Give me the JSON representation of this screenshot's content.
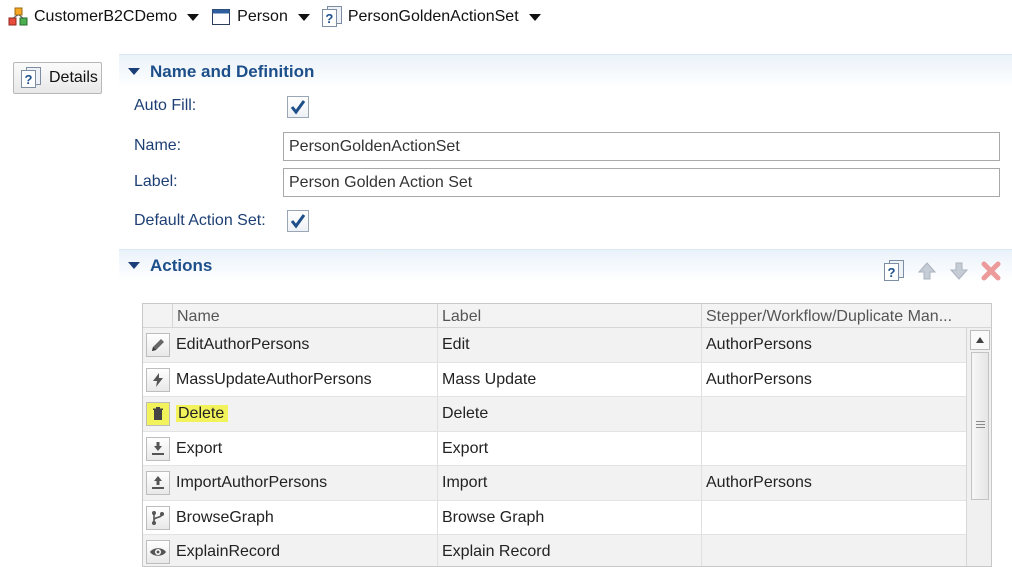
{
  "breadcrumb": [
    {
      "label": "CustomerB2CDemo",
      "icon": "model-cubes-icon"
    },
    {
      "label": "Person",
      "icon": "window-icon"
    },
    {
      "label": "PersonGoldenActionSet",
      "icon": "help-document-icon"
    }
  ],
  "details_button": {
    "label": "Details",
    "icon": "help-document-icon"
  },
  "name_section": {
    "title": "Name and Definition",
    "auto_fill_label": "Auto Fill:",
    "auto_fill_checked": true,
    "name_label": "Name:",
    "name_value": "PersonGoldenActionSet",
    "label_label": "Label:",
    "label_value": "Person Golden Action Set",
    "default_label": "Default Action Set:",
    "default_checked": true
  },
  "actions_section": {
    "title": "Actions",
    "toolbar": [
      "add-help-icon",
      "move-up-icon",
      "move-down-icon",
      "delete-x-icon"
    ],
    "columns": [
      "Name",
      "Label",
      "Stepper/Workflow/Duplicate Man..."
    ],
    "rows": [
      {
        "icon": "pencil-icon",
        "name": "EditAuthorPersons",
        "label": "Edit",
        "target": "AuthorPersons"
      },
      {
        "icon": "lightning-icon",
        "name": "MassUpdateAuthorPersons",
        "label": "Mass Update",
        "target": "AuthorPersons"
      },
      {
        "icon": "trash-icon",
        "name": "Delete",
        "label": "Delete",
        "target": ""
      },
      {
        "icon": "download-icon",
        "name": "Export",
        "label": "Export",
        "target": ""
      },
      {
        "icon": "upload-icon",
        "name": "ImportAuthorPersons",
        "label": "Import",
        "target": "AuthorPersons"
      },
      {
        "icon": "branch-icon",
        "name": "BrowseGraph",
        "label": "Browse Graph",
        "target": ""
      },
      {
        "icon": "eye-icon",
        "name": "ExplainRecord",
        "label": "Explain Record",
        "target": ""
      }
    ]
  },
  "colors": {
    "accent": "#1d4f8a",
    "label": "#1d3f74",
    "highlight": "#f2f25a",
    "delete": "#e06060"
  }
}
